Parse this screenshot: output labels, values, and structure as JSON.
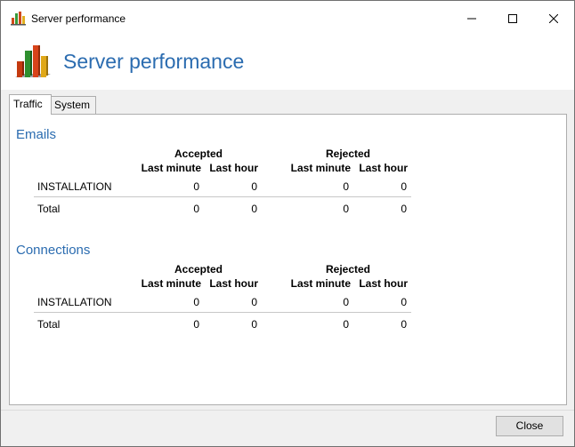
{
  "window": {
    "title": "Server performance",
    "icon": "bar-chart-icon"
  },
  "header": {
    "title": "Server performance",
    "icon": "bar-chart-icon"
  },
  "tabs": [
    {
      "label": "Traffic",
      "active": true
    },
    {
      "label": "System",
      "active": false
    }
  ],
  "traffic": {
    "emails": {
      "title": "Emails",
      "groups": [
        "Accepted",
        "Rejected"
      ],
      "columns": [
        "Last minute",
        "Last hour",
        "Last minute",
        "Last hour"
      ],
      "rows": [
        {
          "label": "INSTALLATION",
          "values": [
            "0",
            "0",
            "0",
            "0"
          ]
        },
        {
          "label": "Total",
          "values": [
            "0",
            "0",
            "0",
            "0"
          ]
        }
      ]
    },
    "connections": {
      "title": "Connections",
      "groups": [
        "Accepted",
        "Rejected"
      ],
      "columns": [
        "Last minute",
        "Last hour",
        "Last minute",
        "Last hour"
      ],
      "rows": [
        {
          "label": "INSTALLATION",
          "values": [
            "0",
            "0",
            "0",
            "0"
          ]
        },
        {
          "label": "Total",
          "values": [
            "0",
            "0",
            "0",
            "0"
          ]
        }
      ]
    }
  },
  "footer": {
    "close_label": "Close"
  },
  "colors": {
    "accent": "#2b6cb0",
    "chrome": "#f0f0f0"
  }
}
